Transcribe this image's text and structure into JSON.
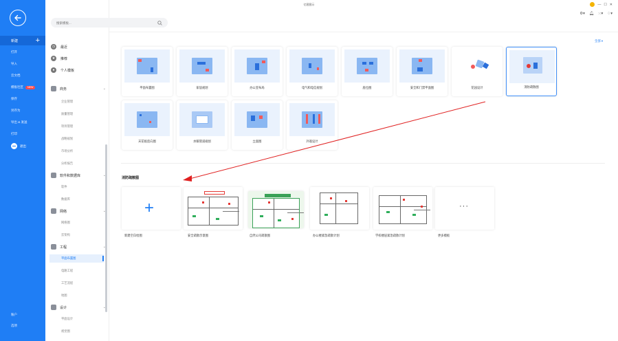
{
  "app": {
    "title": "亿图图示"
  },
  "rail": {
    "new_label": "新建",
    "items": [
      "打开",
      "导入",
      "云文档",
      "模板社区",
      "保存",
      "另存为",
      "导出 & 发送",
      "打印"
    ],
    "new_badge": "NEW",
    "exit_label": "退出",
    "bottom_items": [
      "账户",
      "选项"
    ]
  },
  "search": {
    "placeholder": "搜索模板..."
  },
  "sidebar": {
    "top": [
      "最近",
      "推荐",
      "个人模板"
    ],
    "categories": [
      {
        "label": "商务",
        "subs": [
          "企业管理",
          "质量管理",
          "项目管理",
          "战略规划",
          "市场分析",
          "分析报告"
        ]
      },
      {
        "label": "软件和数据库",
        "subs": [
          "软件",
          "数据库"
        ]
      },
      {
        "label": "网络",
        "subs": [
          "网络图",
          "云架构"
        ]
      },
      {
        "label": "工程",
        "subs": [
          "平面布置图",
          "电路工程",
          "工艺流程",
          "地图"
        ]
      },
      {
        "label": "设计",
        "subs": [
          "平面设计",
          "视觉图"
        ]
      }
    ],
    "active_sub": "平面布置图"
  },
  "main": {
    "all_label": "全部",
    "cards": [
      "平面布置图",
      "家居规划",
      "办公室布局",
      "电气和电信规划",
      "座位图",
      "安全和门禁平面图",
      "花园设计",
      "消防疏散图",
      "天花板反向图",
      "水暖管道规划",
      "立面图",
      "外观设计"
    ],
    "section_title": "消防疏散图",
    "templates": [
      "新建空白绘图",
      "安全疏散示意图",
      "自然公司疏散图",
      "办公楼紧急疏散计划",
      "学校楼层紧急疏散计划",
      "更多模板"
    ]
  },
  "colors": {
    "accent": "#1f7ef5",
    "arrow": "#e02020"
  }
}
